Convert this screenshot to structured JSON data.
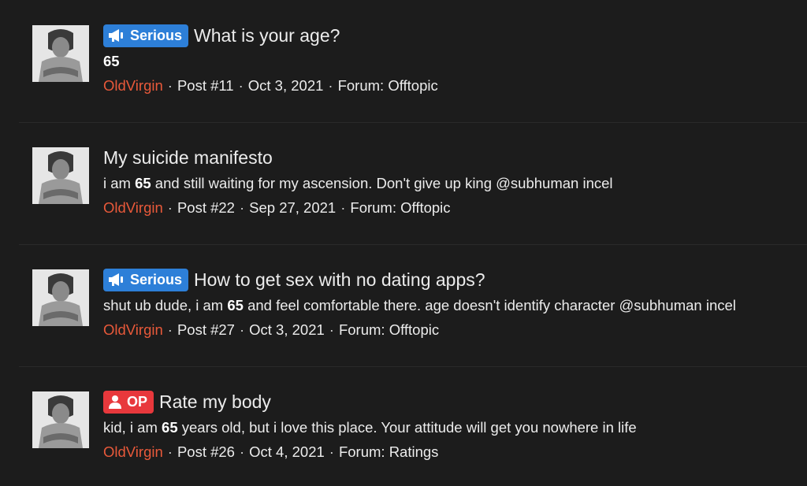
{
  "results": [
    {
      "badge": "Serious",
      "badge_type": "serious",
      "badge_color": "#2d7fd8",
      "title": "What is your age?",
      "snippet_pre": "",
      "snippet_bold": "65",
      "snippet_post": "",
      "author": "OldVirgin",
      "post": "Post #11",
      "date": "Oct 3, 2021",
      "forum": "Forum: Offtopic"
    },
    {
      "badge": "",
      "badge_type": "none",
      "title": "My suicide manifesto",
      "snippet_pre": "i am ",
      "snippet_bold": "65",
      "snippet_post": " and still waiting for my ascension. Don't give up king @subhuman incel",
      "author": "OldVirgin",
      "post": "Post #22",
      "date": "Sep 27, 2021",
      "forum": "Forum: Offtopic"
    },
    {
      "badge": "Serious",
      "badge_type": "serious",
      "badge_color": "#2d7fd8",
      "title": "How to get sex with no dating apps?",
      "snippet_pre": "shut ub dude, i am ",
      "snippet_bold": "65",
      "snippet_post": " and feel comfortable there. age doesn't identify character @subhuman incel",
      "author": "OldVirgin",
      "post": "Post #27",
      "date": "Oct 3, 2021",
      "forum": "Forum: Offtopic"
    },
    {
      "badge": "OP",
      "badge_type": "op",
      "badge_color": "#e8383c",
      "title": "Rate my body",
      "snippet_pre": "kid, i am ",
      "snippet_bold": "65",
      "snippet_post": " years old, but i love this place. Your attitude will get you nowhere in life",
      "author": "OldVirgin",
      "post": "Post #26",
      "date": "Oct 4, 2021",
      "forum": "Forum: Ratings"
    }
  ],
  "colors": {
    "background": "#1c1c1c",
    "author": "#e8593a",
    "serious_badge": "#2d7fd8",
    "op_badge": "#e8383c"
  },
  "separator": "·"
}
